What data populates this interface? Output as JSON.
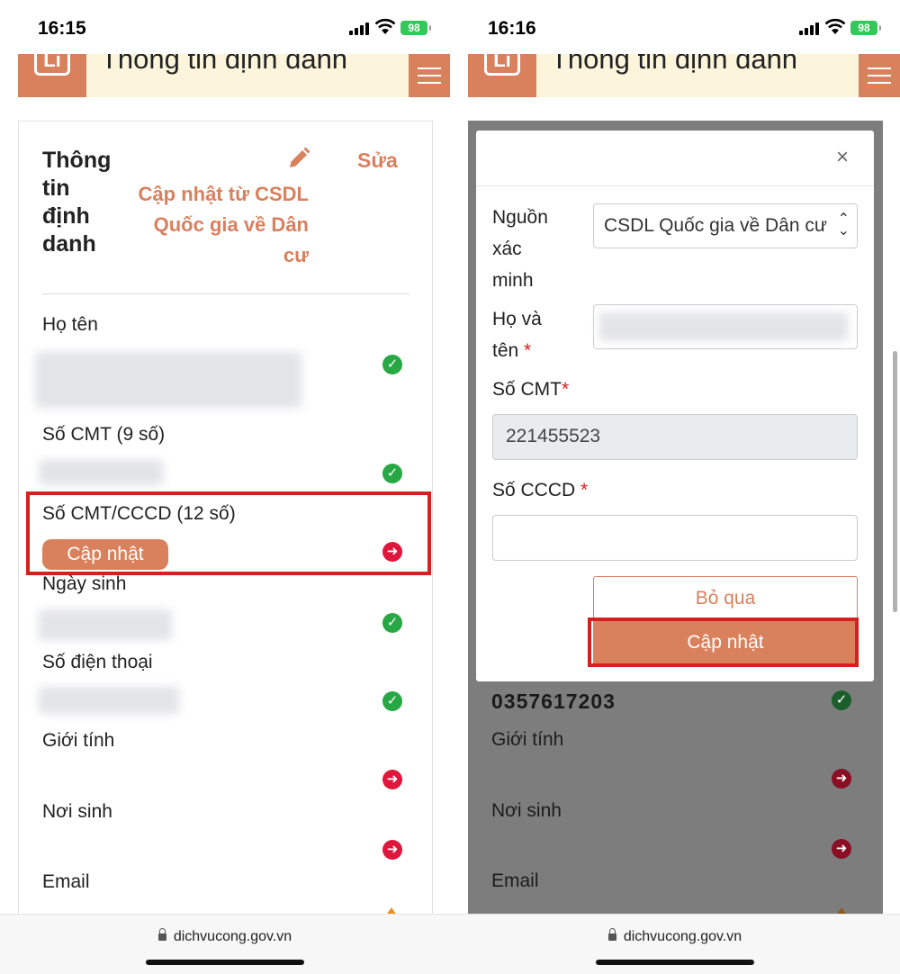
{
  "left": {
    "status_time": "16:15",
    "battery": "98",
    "header_title": "Thông tin định danh",
    "logo_text": "Li",
    "card": {
      "title": "Thông tin định danh",
      "edit_label": "Sửa",
      "sync_label": "Cập nhật từ CSDL Quốc gia về Dân cư"
    },
    "fields": {
      "name": "Họ tên",
      "cmt9": "Số CMT (9 số)",
      "cccd12": "Số CMT/CCCD (12 số)",
      "update_button": "Cập nhật",
      "dob": "Ngày sinh",
      "phone": "Số điện thoại",
      "gender": "Giới tính",
      "birthplace": "Nơi sinh",
      "email": "Email"
    },
    "url": "dichvucong.gov.vn"
  },
  "right": {
    "status_time": "16:16",
    "battery": "98",
    "header_title": "Thông tin định danh",
    "logo_text": "Li",
    "modal": {
      "close": "×",
      "source_label": "Nguồn xác minh",
      "source_value": "CSDL Quốc gia về Dân cư",
      "fullname_label": "Họ và tên",
      "cmt_label": "Số CMT",
      "cmt_value": "221455523",
      "cccd_label": "Số CCCD",
      "cccd_value": "",
      "skip_button": "Bỏ qua",
      "update_button": "Cập nhật"
    },
    "phone_value": "0357617203",
    "fields": {
      "gender": "Giới tính",
      "birthplace": "Nơi sinh",
      "email": "Email"
    },
    "url": "dichvucong.gov.vn"
  },
  "colors": {
    "accent": "#d9805d",
    "ok": "#28a745",
    "action": "#e0173c",
    "highlight": "#d61f1f",
    "header_bg": "#fcf5dc"
  },
  "icons": [
    "pencil-icon",
    "check-circle-icon",
    "arrow-circle-icon",
    "close-icon",
    "chevron-updown-icon",
    "lock-icon",
    "menu-icon"
  ]
}
